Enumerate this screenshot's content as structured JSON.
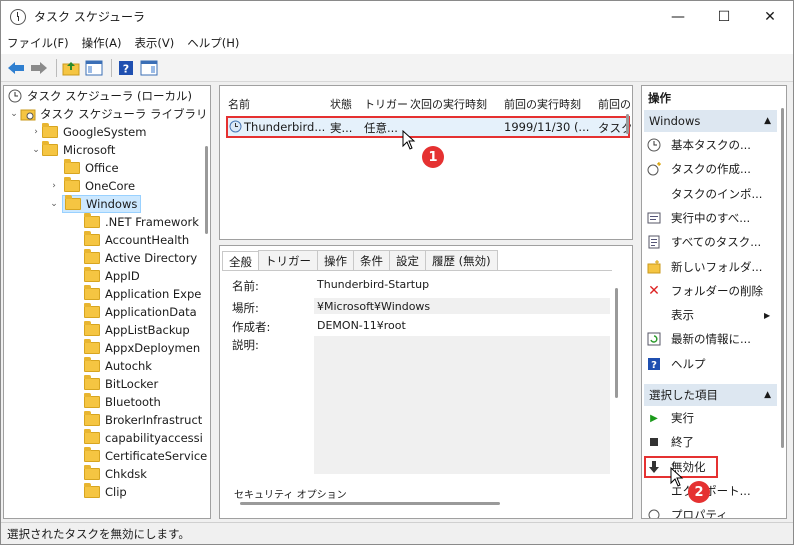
{
  "window": {
    "title": "タスク スケジューラ",
    "minimize": "—",
    "maximize": "☐",
    "close": "✕"
  },
  "menu": [
    "ファイル(F)",
    "操作(A)",
    "表示(V)",
    "ヘルプ(H)"
  ],
  "tree": {
    "root": "タスク スケジューラ (ローカル)",
    "library": "タスク スケジューラ ライブラリ",
    "google": "GoogleSystem",
    "microsoft": "Microsoft",
    "office": "Office",
    "onecore": "OneCore",
    "windows": "Windows",
    "children": [
      ".NET Framework",
      "AccountHealth",
      "Active Directory",
      "AppID",
      "Application Expe",
      "ApplicationData",
      "AppListBackup",
      "AppxDeploymen",
      "Autochk",
      "BitLocker",
      "Bluetooth",
      "BrokerInfrastruct",
      "capabilityaccessi",
      "CertificateService",
      "Chkdsk",
      "Clip"
    ]
  },
  "list": {
    "columns": [
      "名前",
      "状態",
      "トリガー",
      "次回の実行時刻",
      "前回の実行時刻",
      "前回の"
    ],
    "row": {
      "name": "Thunderbird...",
      "status": "実...",
      "trigger": "任意...",
      "next": "",
      "last": "1999/11/30 (...",
      "result": "タスク"
    }
  },
  "detail": {
    "tabs": [
      "全般",
      "トリガー",
      "操作",
      "条件",
      "設定",
      "履歴 (無効)"
    ],
    "name_label": "名前:",
    "name_value": "Thunderbird-Startup",
    "location_label": "場所:",
    "location_value": "¥Microsoft¥Windows",
    "author_label": "作成者:",
    "author_value": "DEMON-11¥root",
    "desc_label": "説明:",
    "security_label": "セキュリティ オプション"
  },
  "actions": {
    "header": "操作",
    "section1": "Windows",
    "items1": [
      "基本タスクの...",
      "タスクの作成...",
      "タスクのインポ...",
      "実行中のすべ...",
      "すべてのタスク...",
      "新しいフォルダ...",
      "フォルダーの削除",
      "表示",
      "最新の情報に...",
      "ヘルプ"
    ],
    "section2": "選択した項目",
    "items2": [
      "実行",
      "終了",
      "無効化",
      "エクスポート...",
      "プロパティ"
    ]
  },
  "badges": [
    "1",
    "2"
  ],
  "status": "選択されたタスクを無効にします。",
  "colors": {
    "highlight": "#e53131",
    "selection": "#cce8ff",
    "section": "#dde7f1"
  }
}
